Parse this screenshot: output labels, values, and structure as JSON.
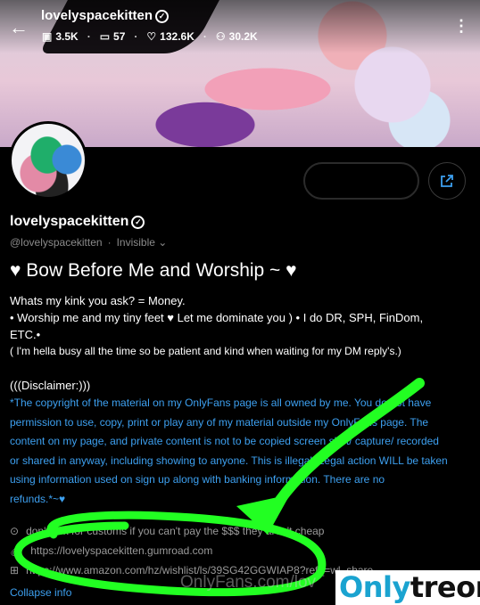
{
  "header": {
    "username": "lovelyspacekitten",
    "stats": {
      "photos": "3.5K",
      "videos": "57",
      "likes": "132.6K",
      "fans": "30.2K"
    }
  },
  "profile": {
    "display_name": "lovelyspacekitten",
    "handle": "@lovelyspacekitten",
    "status": "Invisible"
  },
  "bio": {
    "headline": "♥ Bow Before Me and Worship ~ ♥",
    "line1": "Whats my kink you ask? = Money.",
    "line2": "• Worship me and my tiny feet ♥ Let me dominate you ) • I do DR, SPH, FinDom,",
    "line3": "ETC.•",
    "line4": "( I'm hella busy all the time so be patient and kind when waiting for my DM reply's.)",
    "disclaimer_title": "(((Disclaimer:)))",
    "disclaimer_1": "*The copyright of the material on my OnlyFans page is all owned by me. You do not have",
    "disclaimer_2": "permission to use, copy, print or play any of my material outside my OnlyFans page. The",
    "disclaimer_3": "content on my page, and private content is not to be copied screen shot/ capture/ recorded",
    "disclaimer_4": "or shared in anyway, including showing to anyone. This is illegal. Legal action WILL be taken",
    "disclaimer_5": "using information used on sign up along with banking information. There are no",
    "disclaimer_6": "refunds.*~♥"
  },
  "info": {
    "location": "don't ask for customs if you can't pay the $$$ they aren't cheap",
    "link1": "https://lovelyspacekitten.gumroad.com",
    "link2": "https://www.amazon.com/hz/wishlist/ls/39SG42GGWIAP8?ref_=wl_share"
  },
  "collapse_label": "Collapse info",
  "watermarks": {
    "onlyfans": "OnlyFans.com/lov",
    "site_a": "Only",
    "site_b": "treon"
  },
  "icons": {
    "back": "arrow-left-icon",
    "more": "vertical-dots-icon",
    "share": "share-icon",
    "verified": "verified-check-icon",
    "photos": "image-icon",
    "videos": "video-icon",
    "likes": "heart-icon",
    "fans": "user-icon",
    "location": "location-pin-icon",
    "link": "link-icon",
    "gift": "gift-icon"
  },
  "colors": {
    "link_blue": "#3da0f0",
    "highlight_green": "#22ff22",
    "background": "#000000"
  }
}
